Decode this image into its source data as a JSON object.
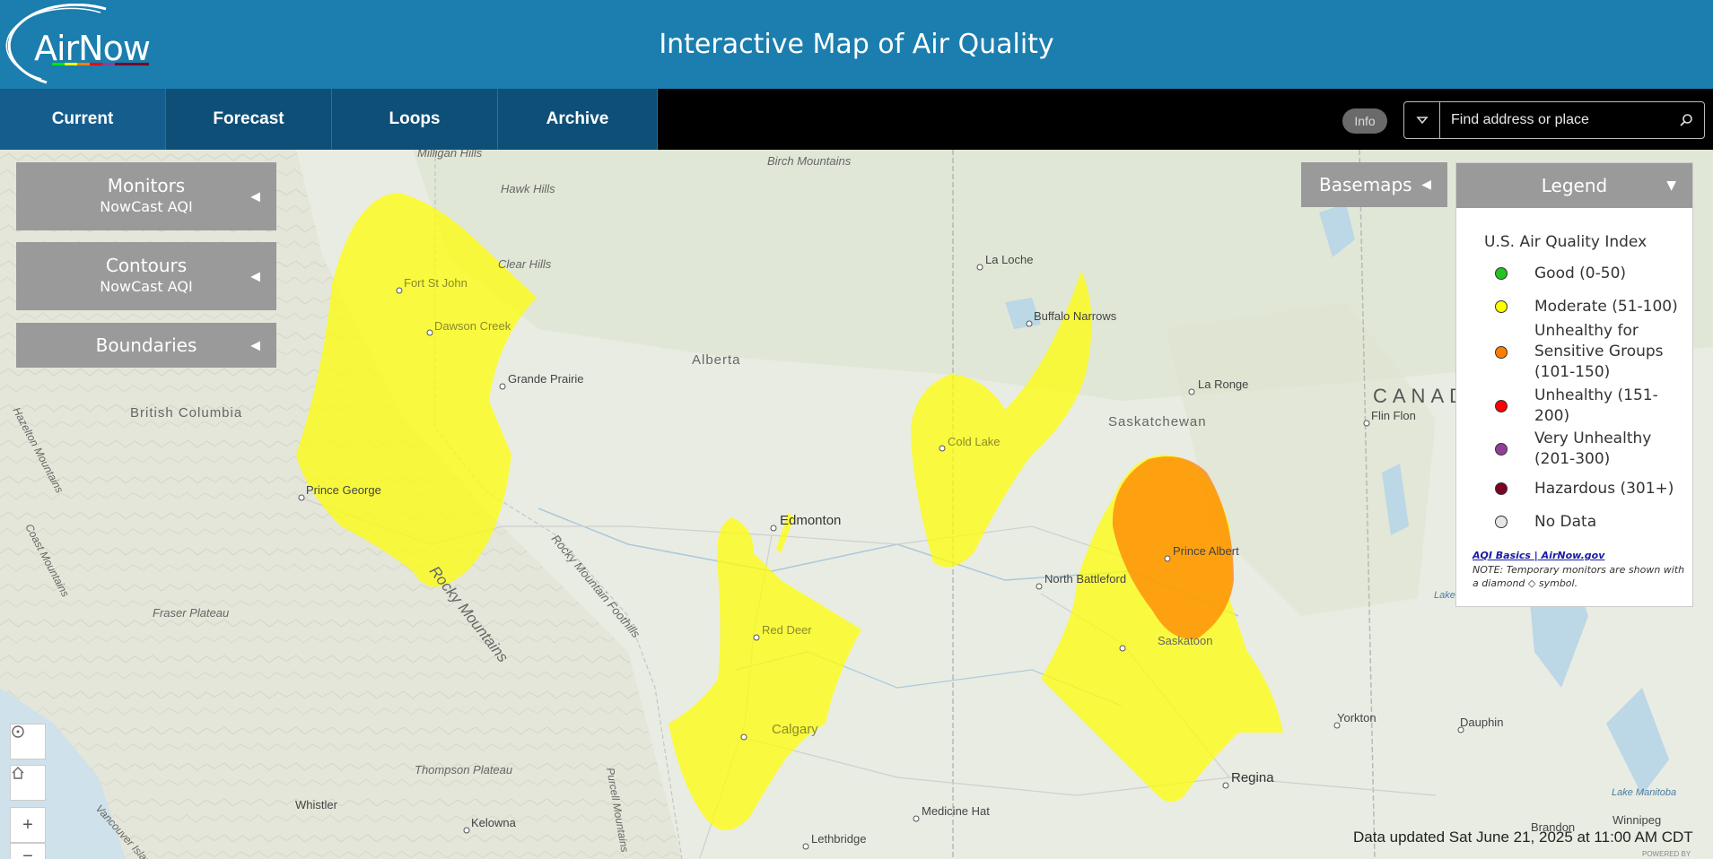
{
  "header": {
    "logo_text": "AirNow",
    "title": "Interactive Map of Air Quality"
  },
  "nav": {
    "tabs": [
      {
        "label": "Current"
      },
      {
        "label": "Forecast"
      },
      {
        "label": "Loops"
      },
      {
        "label": "Archive"
      }
    ],
    "info_label": "Info",
    "search_placeholder": "Find address or place"
  },
  "panels": {
    "monitors": {
      "title": "Monitors",
      "subtitle": "NowCast AQI"
    },
    "contours": {
      "title": "Contours",
      "subtitle": "NowCast AQI"
    },
    "boundaries": {
      "title": "Boundaries"
    },
    "basemaps": {
      "title": "Basemaps"
    }
  },
  "legend": {
    "header": "Legend",
    "title": "U.S. Air Quality Index",
    "items": [
      {
        "label": "Good (0-50)",
        "color": "#22c322"
      },
      {
        "label": "Moderate (51-100)",
        "color": "#ffff00"
      },
      {
        "label": "Unhealthy for Sensitive Groups (101-150)",
        "color": "#ff7e00"
      },
      {
        "label": "Unhealthy (151-200)",
        "color": "#ff0000"
      },
      {
        "label": "Very Unhealthy (201-300)",
        "color": "#8f3f97"
      },
      {
        "label": "Hazardous (301+)",
        "color": "#7e0023"
      },
      {
        "label": "No Data",
        "color": "#e6e6e6"
      }
    ],
    "link": "AQI Basics | AirNow.gov",
    "note": "NOTE: Temporary monitors are shown with a diamond ◇ symbol."
  },
  "map": {
    "places": [
      {
        "name": "Milligan Hills"
      },
      {
        "name": "Hawk Hills"
      },
      {
        "name": "Birch Mountains"
      },
      {
        "name": "Fort St John"
      },
      {
        "name": "Clear Hills"
      },
      {
        "name": "Dawson Creek"
      },
      {
        "name": "La Loche"
      },
      {
        "name": "Buffalo Narrows"
      },
      {
        "name": "Grande Prairie"
      },
      {
        "name": "Alberta"
      },
      {
        "name": "La Ronge"
      },
      {
        "name": "British Columbia"
      },
      {
        "name": "Saskatchewan"
      },
      {
        "name": "Flin Flon"
      },
      {
        "name": "CANADA"
      },
      {
        "name": "Cold Lake"
      },
      {
        "name": "Prince George"
      },
      {
        "name": "Edmonton"
      },
      {
        "name": "Prince Albert"
      },
      {
        "name": "North Battleford"
      },
      {
        "name": "Red Deer"
      },
      {
        "name": "Saskatoon"
      },
      {
        "name": "Fraser Plateau"
      },
      {
        "name": "Rocky Mountains"
      },
      {
        "name": "Rocky Mountain Foothills"
      },
      {
        "name": "Calgary"
      },
      {
        "name": "Yorkton"
      },
      {
        "name": "Dauphin"
      },
      {
        "name": "Regina"
      },
      {
        "name": "Thompson Plateau"
      },
      {
        "name": "Whistler"
      },
      {
        "name": "Kelowna"
      },
      {
        "name": "Medicine Hat"
      },
      {
        "name": "Lethbridge"
      },
      {
        "name": "Brandon"
      },
      {
        "name": "Winnipeg"
      },
      {
        "name": "Lake Winnipegosis"
      },
      {
        "name": "Lake Manitoba"
      },
      {
        "name": "Hazelton Mountains"
      },
      {
        "name": "Coast Mountains"
      },
      {
        "name": "Purcell Mountains"
      },
      {
        "name": "Vancouver Island"
      }
    ]
  },
  "status": {
    "data_updated": "Data updated Sat June 21, 2025 at 11:00 AM CDT",
    "powered": "POWERED BY"
  }
}
